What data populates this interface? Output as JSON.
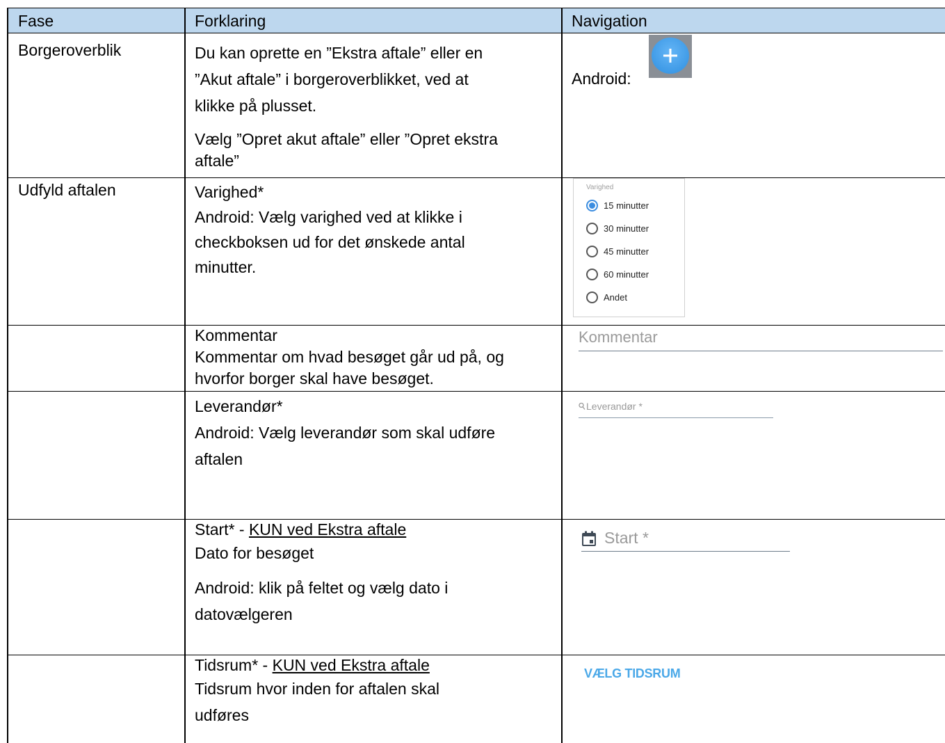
{
  "headers": {
    "fase": "Fase",
    "forklaring": "Forklaring",
    "navigation": "Navigation"
  },
  "rows": [
    {
      "fase": "Borgeroverblik",
      "forklaring_lines": [
        "Du kan oprette en ”Ekstra aftale” eller en",
        "”Akut aftale” i borgeroverblikket, ved at",
        "klikke på plusset.",
        "Vælg ”Opret akut aftale” eller ”Opret ekstra",
        "aftale”"
      ],
      "navigation_label": "Android:",
      "navigation_icon": "plus-fab-icon"
    },
    {
      "fase": "Udfyld aftalen",
      "title": "Varighed*",
      "forklaring_lines": [
        "Android:  Vælg varighed ved at klikke i",
        "checkboksen ud for det ønskede antal",
        "minutter."
      ],
      "widget": {
        "title": "Varighed",
        "options": [
          "15 minutter",
          "30 minutter",
          "45 minutter",
          "60 minutter",
          "Andet"
        ],
        "selected": "15 minutter"
      }
    },
    {
      "fase": "",
      "title": "Kommentar",
      "forklaring_lines": [
        "Kommentar om hvad besøget går ud på, og",
        "hvorfor borger skal have besøget."
      ],
      "widget": {
        "placeholder": "Kommentar"
      }
    },
    {
      "fase": "",
      "title": "Leverandør*",
      "forklaring_lines": [
        "Android: Vælg leverandør som skal udføre",
        "aftalen"
      ],
      "widget": {
        "placeholder": "Leverandør *",
        "icon": "search-icon"
      }
    },
    {
      "fase": "",
      "title_prefix": "Start* - ",
      "title_underlined": "KUN ved Ekstra aftale",
      "forklaring_lines": [
        "Dato for besøget",
        "Android: klik på feltet og vælg dato i",
        "datovælgeren"
      ],
      "widget": {
        "placeholder": "Start *",
        "icon": "calendar-icon"
      }
    },
    {
      "fase": "",
      "title_prefix": "Tidsrum* - ",
      "title_underlined": "KUN ved Ekstra aftale",
      "forklaring_lines": [
        "Tidsrum hvor inden for aftalen skal",
        "udføres"
      ],
      "widget": {
        "button_label": "VÆLG TIDSRUM"
      }
    }
  ],
  "colors": {
    "header_bg": "#bdd7ee",
    "accent_blue": "#3b8de0",
    "button_text": "#4aa8e8"
  }
}
